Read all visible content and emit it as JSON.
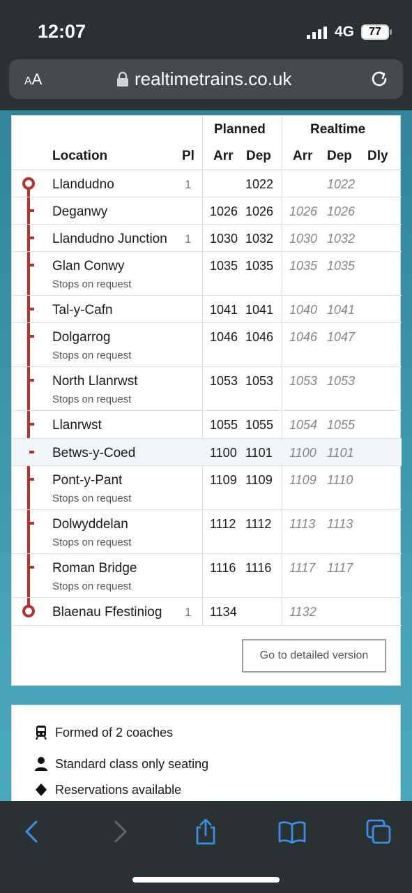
{
  "status": {
    "time": "12:07",
    "network": "4G",
    "battery": "77"
  },
  "browser": {
    "text_size_label_small": "A",
    "text_size_label": "A",
    "url": "realtimetrains.co.uk"
  },
  "table": {
    "group_planned": "Planned",
    "group_realtime": "Realtime",
    "col_location": "Location",
    "col_pl": "Pl",
    "col_p_arr": "Arr",
    "col_p_dep": "Dep",
    "col_r_arr": "Arr",
    "col_r_dep": "Dep",
    "col_dly": "Dly",
    "rows": [
      {
        "location": "Llandudno",
        "sub": "",
        "pl": "1",
        "p_arr": "",
        "p_dep": "1022",
        "r_arr": "",
        "r_dep": "1022"
      },
      {
        "location": "Deganwy",
        "sub": "",
        "pl": "",
        "p_arr": "1026",
        "p_dep": "1026",
        "r_arr": "1026",
        "r_dep": "1026"
      },
      {
        "location": "Llandudno Junction",
        "sub": "",
        "pl": "1",
        "p_arr": "1030",
        "p_dep": "1032",
        "r_arr": "1030",
        "r_dep": "1032"
      },
      {
        "location": "Glan Conwy",
        "sub": "Stops on request",
        "pl": "",
        "p_arr": "1035",
        "p_dep": "1035",
        "r_arr": "1035",
        "r_dep": "1035"
      },
      {
        "location": "Tal-y-Cafn",
        "sub": "",
        "pl": "",
        "p_arr": "1041",
        "p_dep": "1041",
        "r_arr": "1040",
        "r_dep": "1041"
      },
      {
        "location": "Dolgarrog",
        "sub": "Stops on request",
        "pl": "",
        "p_arr": "1046",
        "p_dep": "1046",
        "r_arr": "1046",
        "r_dep": "1047"
      },
      {
        "location": "North Llanrwst",
        "sub": "Stops on request",
        "pl": "",
        "p_arr": "1053",
        "p_dep": "1053",
        "r_arr": "1053",
        "r_dep": "1053"
      },
      {
        "location": "Llanrwst",
        "sub": "",
        "pl": "",
        "p_arr": "1055",
        "p_dep": "1055",
        "r_arr": "1054",
        "r_dep": "1055"
      },
      {
        "location": "Betws-y-Coed",
        "sub": "",
        "pl": "",
        "p_arr": "1100",
        "p_dep": "1101",
        "r_arr": "1100",
        "r_dep": "1101"
      },
      {
        "location": "Pont-y-Pant",
        "sub": "Stops on request",
        "pl": "",
        "p_arr": "1109",
        "p_dep": "1109",
        "r_arr": "1109",
        "r_dep": "1110"
      },
      {
        "location": "Dolwyddelan",
        "sub": "Stops on request",
        "pl": "",
        "p_arr": "1112",
        "p_dep": "1112",
        "r_arr": "1113",
        "r_dep": "1113"
      },
      {
        "location": "Roman Bridge",
        "sub": "Stops on request",
        "pl": "",
        "p_arr": "1116",
        "p_dep": "1116",
        "r_arr": "1117",
        "r_dep": "1117"
      },
      {
        "location": "Blaenau Ffestiniog",
        "sub": "",
        "pl": "1",
        "p_arr": "1134",
        "p_dep": "",
        "r_arr": "1132",
        "r_dep": ""
      }
    ],
    "detail_button": "Go to detailed version"
  },
  "info": {
    "coaches": "Formed of 2 coaches",
    "seating": "Standard class only seating",
    "reservations": "Reservations available"
  },
  "colors": {
    "route": "#b5322f",
    "chrome": "#2a3133",
    "link_blue": "#2f7de1"
  }
}
